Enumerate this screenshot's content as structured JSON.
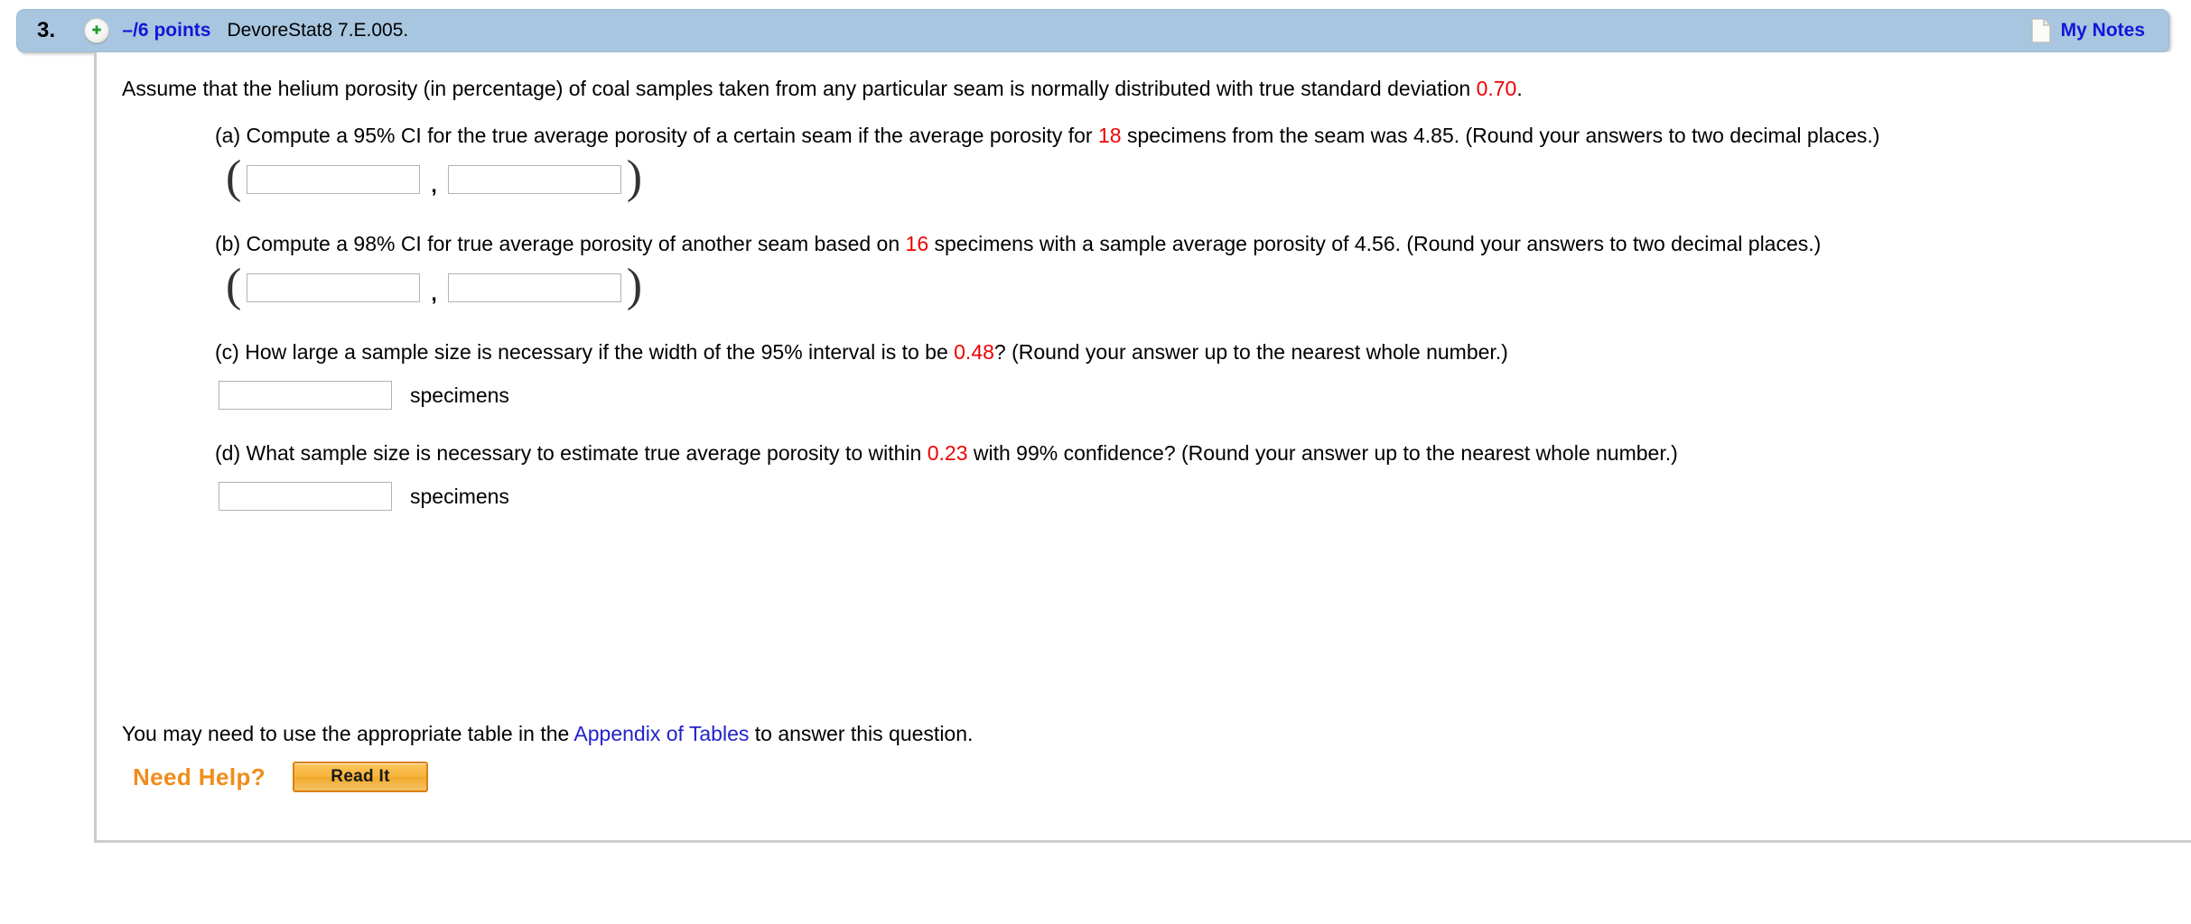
{
  "header": {
    "question_number": "3.",
    "plus_icon": "plus-circle-icon",
    "points": "–/6 points",
    "assignment_code": "DevoreStat8 7.E.005.",
    "notes_icon": "document-icon",
    "notes_label": "My Notes"
  },
  "question": {
    "stem_part1": "Assume that the helium porosity (in percentage) of coal samples taken from any particular seam is normally distributed with true standard deviation ",
    "stem_sigma": "0.70",
    "stem_part2": ".",
    "parts": [
      {
        "id": "a",
        "text_before": "(a) Compute a 95% CI for the true average porosity of a certain seam if the average porosity for ",
        "highlight": "18",
        "text_after": " specimens from the seam was 4.85. (Round your answers to two decimal places.)",
        "answer_type": "interval",
        "open_paren": "(",
        "close_paren": ")",
        "separator": ",",
        "lower_value": "",
        "upper_value": ""
      },
      {
        "id": "b",
        "text_before": "(b) Compute a 98% CI for true average porosity of another seam based on ",
        "highlight": "16",
        "text_after": " specimens with a sample average porosity of 4.56. (Round your answers to two decimal places.)",
        "answer_type": "interval",
        "open_paren": "(",
        "close_paren": ")",
        "separator": ",",
        "lower_value": "",
        "upper_value": ""
      },
      {
        "id": "c",
        "text_before": "(c) How large a sample size is necessary if the width of the 95% interval is to be ",
        "highlight": "0.48",
        "text_after": "? (Round your answer up to the nearest whole number.)",
        "answer_type": "single",
        "value": "",
        "unit": "specimens"
      },
      {
        "id": "d",
        "text_before": "(d) What sample size is necessary to estimate true average porosity to within ",
        "highlight": "0.23",
        "text_after": " with 99% confidence? (Round your answer up to the nearest whole number.)",
        "answer_type": "single",
        "value": "",
        "unit": "specimens"
      }
    ]
  },
  "footer": {
    "appendix_before": "You may need to use the appropriate table in the ",
    "appendix_link": "Appendix of Tables",
    "appendix_after": " to answer this question.",
    "need_help_label": "Need Help?",
    "read_it_label": "Read It"
  },
  "colors": {
    "header_bar": "#a8c6e0",
    "points_blue": "#1515d8",
    "highlight_red": "#ee0000",
    "link_blue": "#2222cc",
    "need_help_orange": "#f08c19",
    "button_gold": "#f7b53d"
  }
}
